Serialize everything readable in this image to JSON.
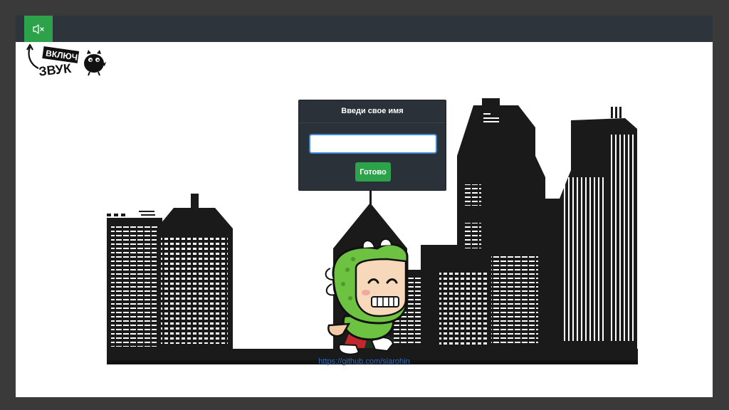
{
  "topbar": {
    "sound_button": {
      "icon": "speaker-muted-icon",
      "state": "muted"
    },
    "hint": {
      "text": "включи звук",
      "icon": "cartoon-bird-icon"
    }
  },
  "login_dialog": {
    "title": "Введи свое имя",
    "input_value": "",
    "input_placeholder": "",
    "submit_label": "Готово"
  },
  "footer": {
    "link": "https://github.com/siarohin"
  },
  "colors": {
    "accent_green": "#2ca24a",
    "topbar": "#2e343b",
    "dialog": "#2b3138",
    "input_focus": "#3f86d4",
    "link": "#2f6fc0",
    "skyline": "#1a1a1a"
  }
}
